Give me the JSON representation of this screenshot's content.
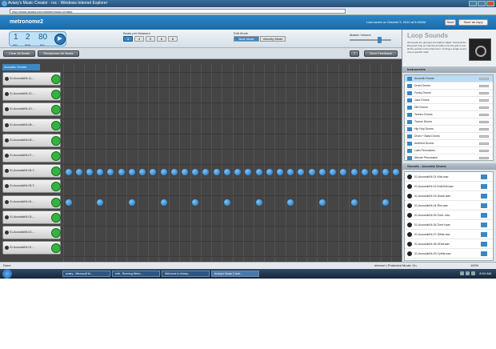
{
  "window": {
    "title": "Aviary's Music Creator - roc - Windows Internet Explorer",
    "url": "http://www.aviary.com/online/music-creator"
  },
  "app": {
    "name": "metronome2",
    "last_saved": "Last saved on October 9, 2010 at 8:00AM",
    "save_label": "Save",
    "save_copy_label": "Save as copy",
    "counter": {
      "bars": "1",
      "beats": "2",
      "tempo": "80",
      "bars_lbl": "bars",
      "beats_lbl": "beats",
      "tempo_lbl": "bpm"
    },
    "beats_label": "Beats per Measure",
    "beats": [
      "3",
      "4",
      "5",
      "6",
      "8"
    ],
    "beats_selected": "3",
    "edit_label": "Edit Mode",
    "edit_modes": [
      "Beat Mode",
      "Velocity Mode"
    ],
    "volume_label": "Master Volume",
    "volume": 0.75,
    "clear_label": "Clear All Beats",
    "randomize_label": "Randomize All Beats",
    "help_label": "?",
    "feedback_label": "Send Feedback",
    "col_header": "Acoustic Drums"
  },
  "tracks": [
    {
      "name": "01-AcousticKit-11-..."
    },
    {
      "name": "01-AcousticKit-12-..."
    },
    {
      "name": "01-AcousticKit-10-..."
    },
    {
      "name": "01-AcousticKit-08-..."
    },
    {
      "name": "01-AcousticKit-09-..."
    },
    {
      "name": "01-AcousticKit-07-..."
    },
    {
      "name": "01-AcousticKit-06-T..."
    },
    {
      "name": "01-AcousticKit-05-T..."
    },
    {
      "name": "01-AcousticKit-04-..."
    },
    {
      "name": "01-AcousticKit-03-..."
    },
    {
      "name": "01-AcousticKit-02-..."
    },
    {
      "name": "01-AcousticKit-01-..."
    }
  ],
  "grid": {
    "columns": 32,
    "active_row_a": 6,
    "active_row_b": 8
  },
  "panel": {
    "title": "Loop Sounds",
    "desc": "All sounds are grouped into folders called \"Instruments\". Drag and drop an Instrument folder onto the grid to use all the sounds in the Instrument. Or drag a single sound onto a specific track.",
    "logo_label": "No Sounds",
    "instruments_title": "Instruments",
    "instruments": [
      "Acoustic Drums",
      "Drum Drums",
      "Funky Drums",
      "Jazz Drums",
      "Dirt Drums",
      "Techno Drums",
      "Trance Drums",
      "Hip Hop Drums",
      "Drum + Bass Drums",
      "Ambient Drums",
      "Latin Percussion",
      "African Percussion"
    ],
    "sounds_title": "Sounds - Acoustic Drums",
    "sounds": [
      "01-AcousticKit-01-Kick.wav",
      "01-AcousticKit-02-KickSoft.wav",
      "01-AcousticKit-03-Snare.wav",
      "01-AcousticKit-04-Rim.wav",
      "01-AcousticKit-05-TomL.wav",
      "01-AcousticKit-06-TomH.wav",
      "01-AcousticKit-07-HiHat.wav",
      "01-AcousticKit-08-OHat.wav",
      "01-AcousticKit-09-CyHat.wav"
    ]
  },
  "status": {
    "left": "Done",
    "zone": "Internet | Protected Mode: On",
    "zoom": "100%"
  },
  "taskbar": {
    "items": [
      "aviary - Microsoft W...",
      "edit - Running Micro...",
      "Welcome to Aviary...",
      "Aviary's Music Creat..."
    ],
    "clock": "8:04 AM"
  }
}
